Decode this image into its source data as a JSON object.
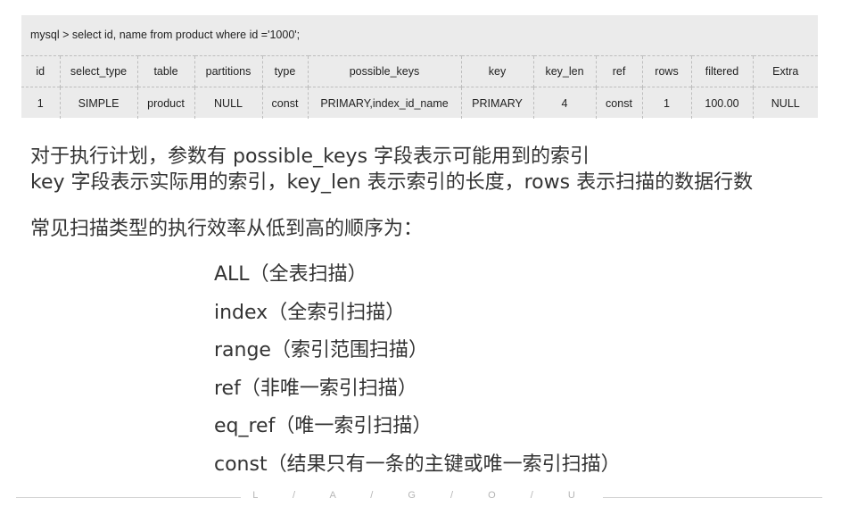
{
  "console": {
    "query": "mysql > select id, name from product where id ='1000';",
    "columns": [
      "id",
      "select_type",
      "table",
      "partitions",
      "type",
      "possible_keys",
      "key",
      "key_len",
      "ref",
      "rows",
      "filtered",
      "Extra"
    ],
    "rows": [
      [
        "1",
        "SIMPLE",
        "product",
        "NULL",
        "const",
        "PRIMARY,index_id_name",
        "PRIMARY",
        "4",
        "const",
        "1",
        "100.00",
        "NULL"
      ]
    ]
  },
  "explanation": {
    "line1": "对于执行计划，参数有 possible_keys 字段表示可能用到的索引",
    "line2": "key 字段表示实际用的索引，key_len 表示索引的长度，rows 表示扫描的数据行数",
    "line3": "常见扫描类型的执行效率从低到高的顺序为："
  },
  "scan_types": [
    "ALL（全表扫描）",
    "index（全索引扫描）",
    "range（索引范围扫描）",
    "ref（非唯一索引扫描）",
    "eq_ref（唯一索引扫描）",
    "const（结果只有一条的主键或唯一索引扫描）"
  ],
  "footer": {
    "brand": "L / A / G / O / U"
  }
}
